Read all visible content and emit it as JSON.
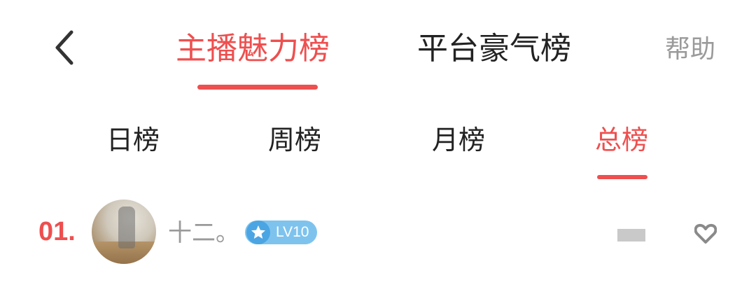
{
  "header": {
    "tabs": [
      {
        "label": "主播魅力榜",
        "active": true
      },
      {
        "label": "平台豪气榜",
        "active": false
      }
    ],
    "help_label": "帮助"
  },
  "sub_tabs": [
    {
      "label": "日榜",
      "active": false
    },
    {
      "label": "周榜",
      "active": false
    },
    {
      "label": "月榜",
      "active": false
    },
    {
      "label": "总榜",
      "active": true
    }
  ],
  "ranking": [
    {
      "rank": "01.",
      "username": "十二。",
      "level": "LV10"
    }
  ],
  "colors": {
    "accent": "#ee4f4f",
    "muted": "#9a9a9a",
    "level_badge": "#7ec3ee"
  },
  "icons": {
    "back": "chevron-left-icon",
    "level": "star-icon",
    "heart": "heart-icon"
  }
}
